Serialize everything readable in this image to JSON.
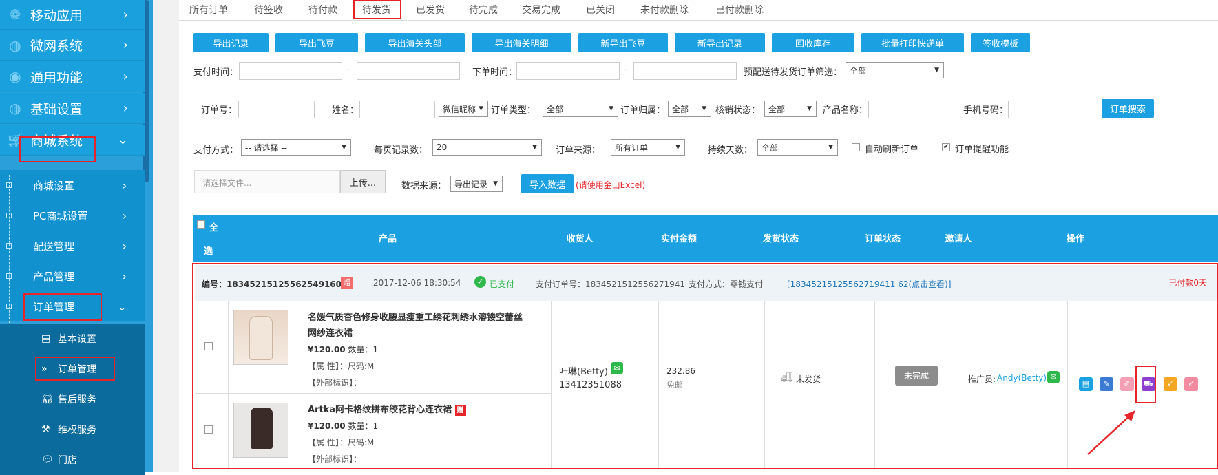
{
  "sidebar": {
    "main_items": [
      {
        "label": "移动应用",
        "icon": "flower-icon"
      },
      {
        "label": "微网系统",
        "icon": "globe-icon"
      },
      {
        "label": "通用功能",
        "icon": "play-circle-icon"
      },
      {
        "label": "基础设置",
        "icon": "globe-icon"
      },
      {
        "label": "商城系统",
        "icon": "cart-icon"
      }
    ],
    "sub_items": [
      "商城设置",
      "PC商城设置",
      "配送管理",
      "产品管理",
      "订单管理"
    ],
    "leaf_items": [
      {
        "label": "基本设置",
        "icon": "clipboard-icon"
      },
      {
        "label": "订单管理",
        "icon": "double-chevron-icon"
      },
      {
        "label": "售后服务",
        "icon": "headset-icon"
      },
      {
        "label": "维权服务",
        "icon": "gavel-icon"
      },
      {
        "label": "门店",
        "icon": "chat-icon"
      }
    ]
  },
  "tabs": [
    "所有订单",
    "待签收",
    "待付款",
    "待发货",
    "已发货",
    "待完成",
    "交易完成",
    "已关闭",
    "未付款删除",
    "已付款删除"
  ],
  "toolbar": [
    "导出记录",
    "导出飞豆",
    "导出海关头部",
    "导出海关明细",
    "新导出飞豆",
    "新导出记录",
    "回收库存",
    "批量打印快递单",
    "签收模板"
  ],
  "filters": {
    "pay_time": "支付时间：",
    "dash": "-",
    "order_time": "下单时间：",
    "presale": "预配送待发货订单筛选：",
    "presale_value": "全部",
    "order_no": "订单号：",
    "name": "姓名：",
    "name_type": "微信昵称",
    "order_type": "订单类型：",
    "order_type_value": "全部",
    "order_owner": "订单归属：",
    "order_owner_value": "全部",
    "verify": "核销状态：",
    "verify_value": "全部",
    "product": "产品名称：",
    "phone": "手机号码：",
    "search_btn": "订单搜索",
    "pay_method": "支付方式：",
    "pay_method_value": "-- 请选择 --",
    "page_size": "每页记录数：",
    "page_size_value": "20",
    "source": "订单来源：",
    "source_value": "所有订单",
    "days": "持续天数：",
    "days_value": "全部",
    "auto_refresh": "自动刷新订单",
    "remind": "订单提醒功能"
  },
  "import": {
    "file_placeholder": "请选择文件...",
    "upload": "上传...",
    "data_source": "数据来源：",
    "data_source_value": "导出记录",
    "import_btn": "导入数据",
    "note": "(请使用金山Excel)"
  },
  "table": {
    "select_all_1": "全",
    "select_all_2": "选",
    "headers": [
      "产品",
      "收货人",
      "实付金额",
      "发货状态",
      "订单状态",
      "邀请人",
      "操作"
    ]
  },
  "order": {
    "number": "编号：18345215125562549160",
    "gift_badge": "赠",
    "time": "2017-12-06 18:30:54",
    "paid": "已支付",
    "pay_order_no": "支付订单号：1834521512556271941",
    "pay_method": "支付方式：零钱支付",
    "pay_link": "[18345215125562719411 62(点击查看)]",
    "paid_days": "已付款0天",
    "products": [
      {
        "title": "名媛气质杏色修身收腰显瘦重工绣花刺绣水溶镂空蕾丝网纱连衣裙",
        "price": "¥120.00",
        "qty": "数量：1",
        "attr": "【属 性】：尺码:M",
        "ext": "【外部标识】：",
        "gift": ""
      },
      {
        "title": "Artka阿卡格纹拼布绞花背心连衣裙",
        "price": "¥120.00",
        "qty": "数量：1",
        "attr": "【属 性】：尺码:M",
        "ext": "【外部标识】：",
        "gift": "赠"
      }
    ],
    "receiver_name": "叶琳(Betty)",
    "receiver_phone": "13412351088",
    "amount": "232.86",
    "amount_note": "免邮",
    "ship_status": "未发货",
    "order_status": "未完成",
    "inviter_label": "推广员:",
    "inviter_name": "Andy(Betty)",
    "actions": [
      {
        "icon": "note-icon",
        "color": "#1ba1e2"
      },
      {
        "icon": "edit-icon",
        "color": "#3b7bd4"
      },
      {
        "icon": "pencil-icon",
        "color": "#f3a0b5"
      },
      {
        "icon": "truck-icon",
        "color": "#8e3fd0"
      },
      {
        "icon": "check-icon",
        "color": "#f5a623"
      },
      {
        "icon": "verify-icon",
        "color": "#f28aa0"
      }
    ]
  }
}
